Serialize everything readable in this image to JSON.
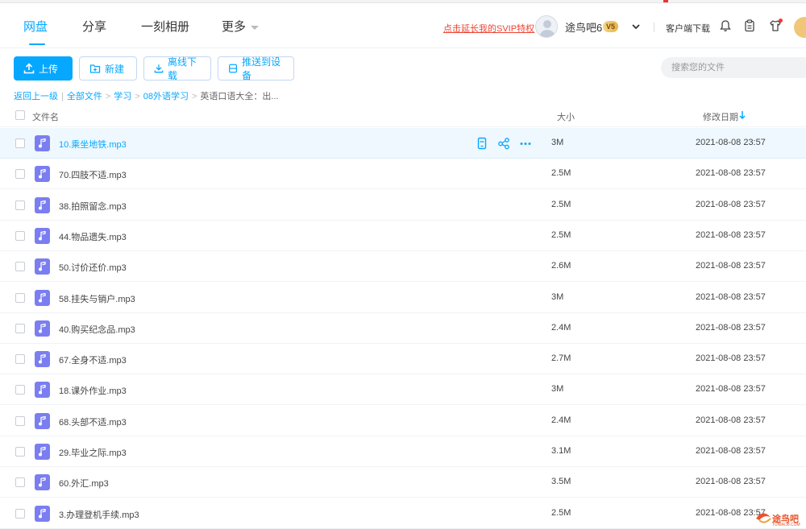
{
  "nav": {
    "tabs": [
      {
        "label": "网盘",
        "active": true
      },
      {
        "label": "分享",
        "active": false
      },
      {
        "label": "一刻相册",
        "active": false
      },
      {
        "label": "更多",
        "active": false
      }
    ]
  },
  "header": {
    "svip_link": "点击延长我的SVIP特权",
    "username": "途鸟吧6",
    "vip_level": "5",
    "client_download": "客户端下载"
  },
  "toolbar": {
    "upload_label": "上传",
    "new_label": "新建",
    "offline_label": "离线下载",
    "push_label": "推送到设备",
    "search_placeholder": "搜索您的文件"
  },
  "breadcrumb": {
    "items": [
      "返回上一级",
      "全部文件",
      "学习",
      "08外语学习"
    ],
    "current": "英语口语大全：出..."
  },
  "table": {
    "headers": {
      "name": "文件名",
      "size": "大小",
      "date": "修改日期"
    },
    "rows": [
      {
        "name": "10.乘坐地铁.mp3",
        "size": "3M",
        "date": "2021-08-08 23:57"
      },
      {
        "name": "70.四肢不适.mp3",
        "size": "2.5M",
        "date": "2021-08-08 23:57"
      },
      {
        "name": "38.拍照留念.mp3",
        "size": "2.5M",
        "date": "2021-08-08 23:57"
      },
      {
        "name": "44.物品遗失.mp3",
        "size": "2.5M",
        "date": "2021-08-08 23:57"
      },
      {
        "name": "50.讨价还价.mp3",
        "size": "2.6M",
        "date": "2021-08-08 23:57"
      },
      {
        "name": "58.挂失与销户.mp3",
        "size": "3M",
        "date": "2021-08-08 23:57"
      },
      {
        "name": "40.购买纪念品.mp3",
        "size": "2.4M",
        "date": "2021-08-08 23:57"
      },
      {
        "name": "67.全身不适.mp3",
        "size": "2.7M",
        "date": "2021-08-08 23:57"
      },
      {
        "name": "18.课外作业.mp3",
        "size": "3M",
        "date": "2021-08-08 23:57"
      },
      {
        "name": "68.头部不适.mp3",
        "size": "2.4M",
        "date": "2021-08-08 23:57"
      },
      {
        "name": "29.毕业之际.mp3",
        "size": "3.1M",
        "date": "2021-08-08 23:57"
      },
      {
        "name": "60.外汇.mp3",
        "size": "3.5M",
        "date": "2021-08-08 23:57"
      },
      {
        "name": "3.办理登机手续.mp3",
        "size": "2.5M",
        "date": "2021-08-08 23:57"
      }
    ]
  },
  "watermark": {
    "text": "途鸟吧",
    "sub": "TUNIAO8.COM"
  },
  "colors": {
    "accent": "#06a7ff",
    "file_icon": "#7b7ef0",
    "svip_link": "#ee4433"
  }
}
